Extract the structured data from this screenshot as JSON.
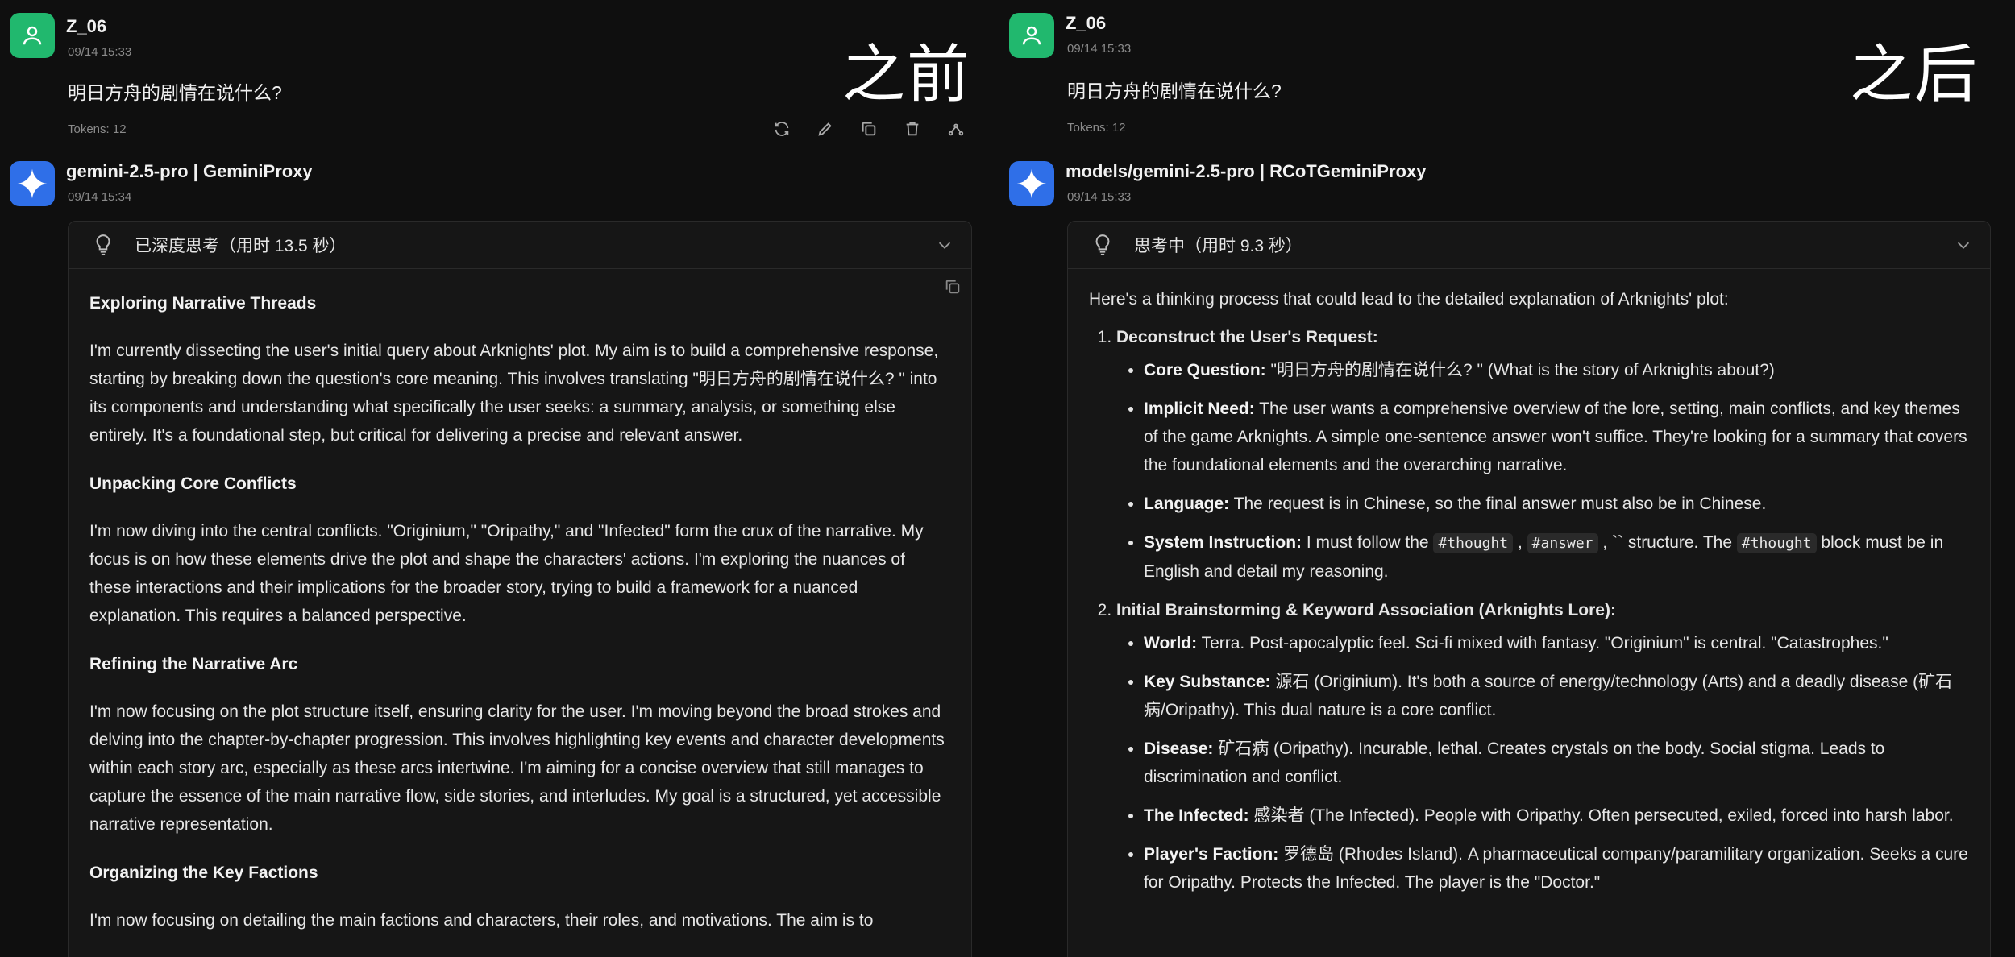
{
  "left": {
    "label": "之前",
    "user": {
      "name": "Z_06",
      "time": "09/14 15:33",
      "question": "明日方舟的剧情在说什么?",
      "tokens": "Tokens: 12"
    },
    "bot": {
      "name": "gemini-2.5-pro | GeminiProxy",
      "time": "09/14 15:34"
    },
    "thought_title": "已深度思考（用时 13.5 秒）",
    "sections": [
      {
        "heading": "Exploring Narrative Threads",
        "text": "I'm currently dissecting the user's initial query about Arknights' plot. My aim is to build a comprehensive response, starting by breaking down the question's core meaning. This involves translating \"明日方舟的剧情在说什么? \" into its components and understanding what specifically the user seeks: a summary, analysis, or something else entirely. It's a foundational step, but critical for delivering a precise and relevant answer."
      },
      {
        "heading": "Unpacking Core Conflicts",
        "text": "I'm now diving into the central conflicts. \"Originium,\" \"Oripathy,\" and \"Infected\" form the crux of the narrative. My focus is on how these elements drive the plot and shape the characters' actions. I'm exploring the nuances of these interactions and their implications for the broader story, trying to build a framework for a nuanced explanation. This requires a balanced perspective."
      },
      {
        "heading": "Refining the Narrative Arc",
        "text": "I'm now focusing on the plot structure itself, ensuring clarity for the user. I'm moving beyond the broad strokes and delving into the chapter-by-chapter progression. This involves highlighting key events and character developments within each story arc, especially as these arcs intertwine. I'm aiming for a concise overview that still manages to capture the essence of the main narrative flow, side stories, and interludes. My goal is a structured, yet accessible narrative representation."
      },
      {
        "heading": "Organizing the Key Factions",
        "text": "I'm now focusing on detailing the main factions and characters, their roles, and motivations. The aim is to"
      }
    ]
  },
  "right": {
    "label": "之后",
    "user": {
      "name": "Z_06",
      "time": "09/14 15:33",
      "question": "明日方舟的剧情在说什么?",
      "tokens": "Tokens: 12"
    },
    "bot": {
      "name": "models/gemini-2.5-pro | RCoTGeminiProxy",
      "time": "09/14 15:33"
    },
    "thought_title": "思考中（用时 9.3 秒）",
    "intro": "Here's a thinking process that could lead to the detailed explanation of Arknights' plot:",
    "list": [
      {
        "title": "Deconstruct the User's Request:",
        "items": [
          {
            "k": "Core Question:",
            "v": " \"明日方舟的剧情在说什么? \" (What is the story of Arknights about?)"
          },
          {
            "k": "Implicit Need:",
            "v": " The user wants a comprehensive overview of the lore, setting, main conflicts, and key themes of the game Arknights. A simple one-sentence answer won't suffice. They're looking for a summary that covers the foundational elements and the overarching narrative."
          },
          {
            "k": "Language:",
            "v": " The request is in Chinese, so the final answer must also be in Chinese."
          },
          {
            "k": "System Instruction:",
            "pre": " I must follow the ",
            "c1": "#thought",
            "mid1": " , ",
            "c2": "#answer",
            "mid2": " , `` structure. The ",
            "c3": "#thought",
            "post": " block must be in English and detail my reasoning."
          }
        ]
      },
      {
        "title": "Initial Brainstorming & Keyword Association (Arknights Lore):",
        "items": [
          {
            "k": "World:",
            "v": " Terra. Post-apocalyptic feel. Sci-fi mixed with fantasy. \"Originium\" is central. \"Catastrophes.\""
          },
          {
            "k": "Key Substance:",
            "v": " 源石 (Originium). It's both a source of energy/technology (Arts) and a deadly disease (矿石病/Oripathy). This dual nature is a core conflict."
          },
          {
            "k": "Disease:",
            "v": " 矿石病 (Oripathy). Incurable, lethal. Creates crystals on the body. Social stigma. Leads to discrimination and conflict."
          },
          {
            "k": "The Infected:",
            "v": " 感染者 (The Infected). People with Oripathy. Often persecuted, exiled, forced into harsh labor."
          },
          {
            "k": "Player's Faction:",
            "v": " 罗德岛 (Rhodes Island). A pharmaceutical company/paramilitary organization. Seeks a cure for Oripathy. Protects the Infected. The player is the \"Doctor.\""
          }
        ]
      }
    ]
  }
}
